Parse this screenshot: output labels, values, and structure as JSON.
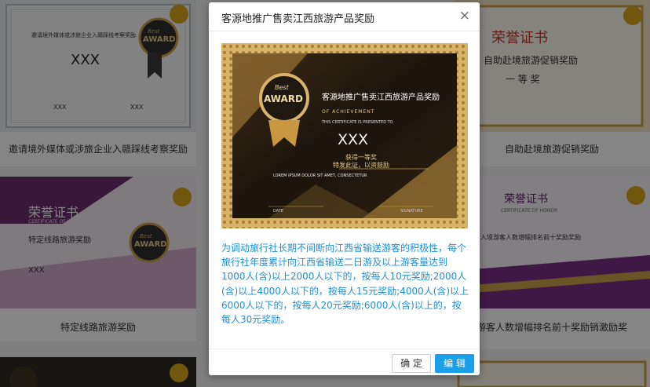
{
  "cards": [
    {
      "caption": "邀请境外媒体或涉旅企业入赣踩线考察奖励",
      "heading": "邀请境外媒体或涉旅企业入赣踩线考察奖励",
      "name": "XXX",
      "badge_top": "Best",
      "badge_main": "AWARD",
      "sig_left": "XXX",
      "sig_right": "XXX"
    },
    {
      "caption": "自助赴境旅游促销奖励",
      "heading": "荣誉证书",
      "subheading": "自助赴境旅游促销奖励",
      "grade": "一 等 奖"
    },
    {
      "caption": "特定线路旅游奖励",
      "heading": "荣誉证书",
      "sub_en": "CERTIFICATE OF HONOR",
      "subheading": "特定线路旅游奖励",
      "name": "XXX",
      "badge_top": "Best",
      "badge_main": "AWARD"
    },
    {
      "caption": "游客人数增幅排名前十奖励销激励奖",
      "heading": "荣誉证书",
      "sub_en": "CERTIFICATE OF HONOR",
      "subheading": "入境游客人数增幅排名前十奖励奖励"
    },
    {
      "caption": ""
    },
    {
      "caption": ""
    }
  ],
  "dialog": {
    "title": "客源地推广售卖江西旅游产品奖励",
    "close": "×",
    "certificate": {
      "badge_top": "Best",
      "badge_main": "AWARD",
      "title": "客源地推广售卖江西旅游产品奖励",
      "of_achievement": "OF ACHIEVEMENT",
      "presented": "THIS CERTIFICATE IS PRESENTED TO",
      "name": "XXX",
      "line1": "获得一等奖",
      "line2": "特发此证，以资鼓励",
      "lorem": "LOREM IPSUM DOLOR SIT AMET, CONSECTETUR",
      "date": "DATE",
      "signature": "SIGNATURE"
    },
    "description": "为调动旅行社长期不间断向江西省输送游客的积极性，每个旅行社年度累计向江西省输送二日游及以上游客量达到1000人(含)以上2000人以下的，按每人10元奖励;2000人(含)以上4000人以下的，按每人15元奖励;4000人(含)以上6000人以下的，按每人20元奖励;6000人(含)以上的，按每人30元奖励。",
    "ok_label": "确 定",
    "edit_label": "编 辑"
  },
  "colors": {
    "accent": "#1aa0e8",
    "gold": "#c9a24a",
    "purple": "#7a2f86"
  }
}
